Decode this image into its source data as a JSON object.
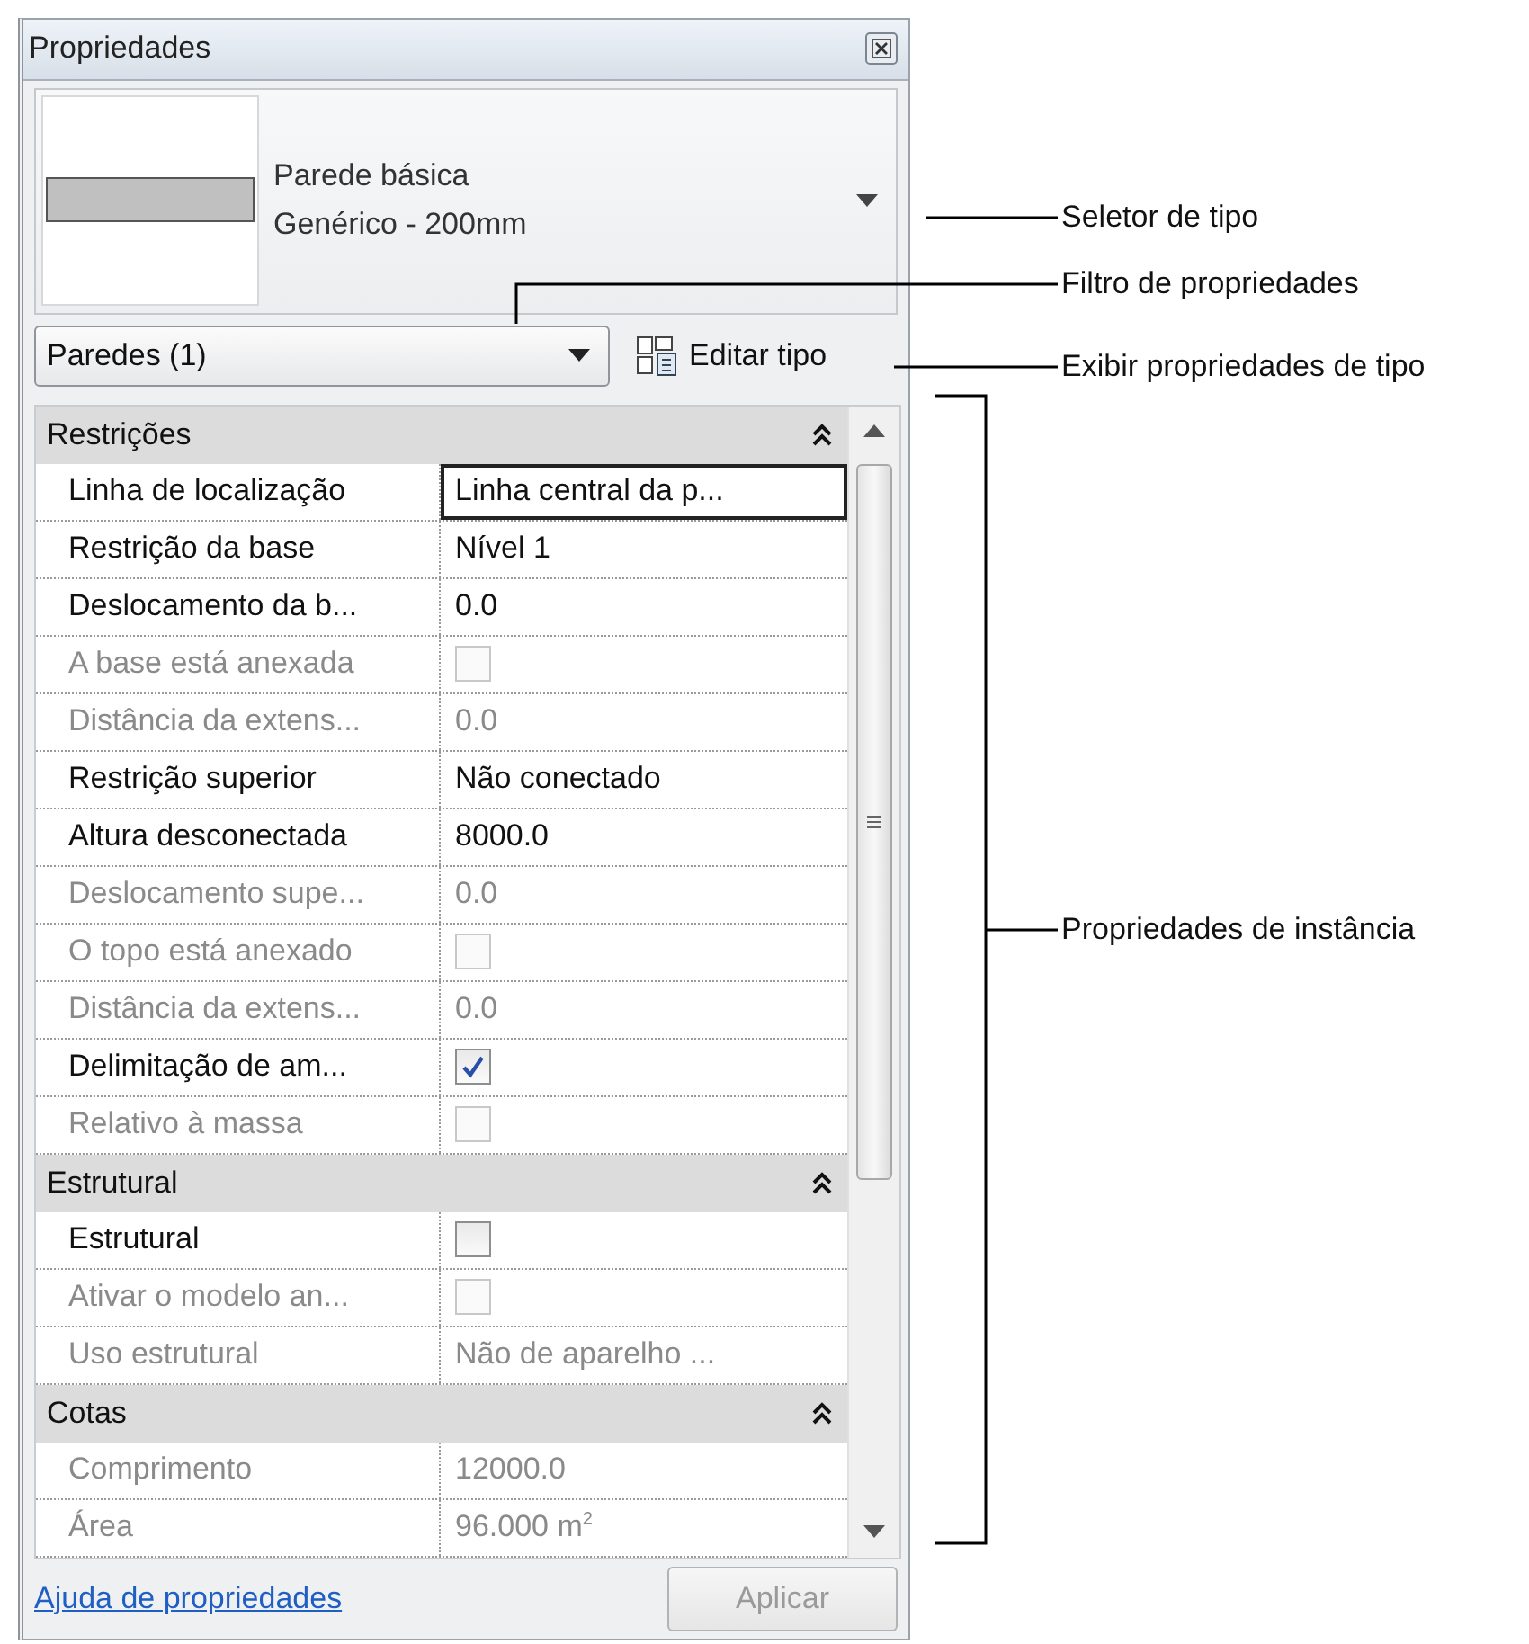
{
  "panel": {
    "title": "Propriedades"
  },
  "type_selector": {
    "family": "Parede básica",
    "type": "Genérico - 200mm"
  },
  "filter": {
    "value": "Paredes (1)"
  },
  "edit_type_button": {
    "label": "Editar tipo"
  },
  "sections": [
    {
      "title": "Restrições",
      "expanded": true,
      "rows": [
        {
          "label": "Linha de localização",
          "kind": "text",
          "value": "Linha central da p...",
          "disabled": false,
          "selected": true
        },
        {
          "label": "Restrição da base",
          "kind": "text",
          "value": "Nível 1",
          "disabled": false,
          "selected": false
        },
        {
          "label": "Deslocamento da b...",
          "kind": "text",
          "value": "0.0",
          "disabled": false,
          "selected": false
        },
        {
          "label": "A base está anexada",
          "kind": "checkbox",
          "checked": false,
          "disabled": true,
          "selected": false
        },
        {
          "label": "Distância da extens...",
          "kind": "text",
          "value": "0.0",
          "disabled": true,
          "selected": false
        },
        {
          "label": "Restrição superior",
          "kind": "text",
          "value": "Não conectado",
          "disabled": false,
          "selected": false
        },
        {
          "label": "Altura desconectada",
          "kind": "text",
          "value": "8000.0",
          "disabled": false,
          "selected": false
        },
        {
          "label": "Deslocamento supe...",
          "kind": "text",
          "value": "0.0",
          "disabled": true,
          "selected": false
        },
        {
          "label": "O topo está anexado",
          "kind": "checkbox",
          "checked": false,
          "disabled": true,
          "selected": false
        },
        {
          "label": "Distância da extens...",
          "kind": "text",
          "value": "0.0",
          "disabled": true,
          "selected": false
        },
        {
          "label": "Delimitação de am...",
          "kind": "checkbox",
          "checked": true,
          "disabled": false,
          "selected": false
        },
        {
          "label": "Relativo à massa",
          "kind": "checkbox",
          "checked": false,
          "disabled": true,
          "selected": false
        }
      ]
    },
    {
      "title": "Estrutural",
      "expanded": true,
      "rows": [
        {
          "label": "Estrutural",
          "kind": "checkbox",
          "checked": false,
          "disabled": false,
          "selected": false
        },
        {
          "label": "Ativar o modelo an...",
          "kind": "checkbox",
          "checked": false,
          "disabled": true,
          "selected": false
        },
        {
          "label": "Uso estrutural",
          "kind": "text",
          "value": "Não de aparelho ...",
          "disabled": true,
          "selected": false
        }
      ]
    },
    {
      "title": "Cotas",
      "expanded": true,
      "rows": [
        {
          "label": "Comprimento",
          "kind": "text",
          "value": "12000.0",
          "disabled": true,
          "selected": false
        },
        {
          "label": "Área",
          "kind": "text",
          "value": "96.000 m$^{2}$",
          "disabled": true,
          "selected": false
        }
      ]
    }
  ],
  "help_link": "Ajuda de propriedades",
  "apply_button": {
    "label": "Aplicar",
    "disabled": true
  },
  "callouts": [
    {
      "label": "Seletor de tipo"
    },
    {
      "label": "Filtro de propriedades"
    },
    {
      "label": "Exibir propriedades de tipo"
    },
    {
      "label": "Propriedades de instância"
    }
  ]
}
